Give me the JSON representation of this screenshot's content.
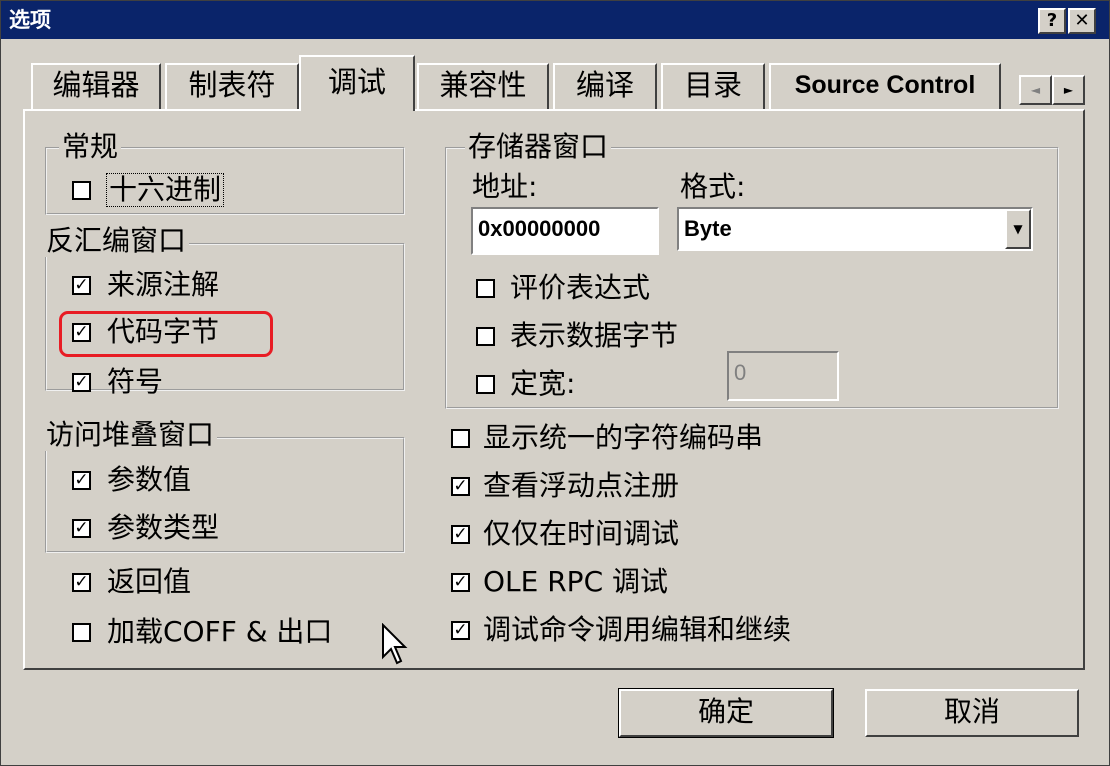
{
  "window": {
    "title": "选项"
  },
  "titlebar": {
    "help": "?",
    "close": "✕"
  },
  "tabs": [
    {
      "label": "编辑器"
    },
    {
      "label": "制表符"
    },
    {
      "label": "调试"
    },
    {
      "label": "兼容性"
    },
    {
      "label": "编译"
    },
    {
      "label": "目录"
    },
    {
      "label": "Source Control"
    }
  ],
  "tab_scroll": {
    "left": "◄",
    "right": "►"
  },
  "general": {
    "title": "常规",
    "items": [
      {
        "label": "十六进制",
        "checked": false
      }
    ]
  },
  "disasm": {
    "title": "反汇编窗口",
    "items": [
      {
        "label": "来源注解",
        "checked": true
      },
      {
        "label": "代码字节",
        "checked": true
      },
      {
        "label": "符号",
        "checked": true
      }
    ]
  },
  "callstack": {
    "title": "访问堆叠窗口",
    "items": [
      {
        "label": "参数值",
        "checked": true
      },
      {
        "label": "参数类型",
        "checked": true
      }
    ]
  },
  "left_extra": [
    {
      "label": "返回值",
      "checked": true
    },
    {
      "label": "加载COFF & 出口",
      "checked": false
    }
  ],
  "memory": {
    "title": "存储器窗口",
    "address_label": "地址:",
    "address_value": "0x00000000",
    "format_label": "格式:",
    "format_value": "Byte",
    "items": [
      {
        "label": "评价表达式",
        "checked": false
      },
      {
        "label": "表示数据字节",
        "checked": false
      },
      {
        "label": "定宽:",
        "checked": false
      }
    ],
    "fixed_width_value": "0"
  },
  "right_extra": [
    {
      "label": "显示统一的字符编码串",
      "checked": false
    },
    {
      "label": "查看浮动点注册",
      "checked": true
    },
    {
      "label": "仅仅在时间调试",
      "checked": true
    },
    {
      "label": "OLE RPC 调试",
      "checked": true
    },
    {
      "label": "调试命令调用编辑和继续",
      "checked": true
    }
  ],
  "buttons": {
    "ok": "确定",
    "cancel": "取消"
  },
  "check_mark": "✓",
  "colors": {
    "titlebar": "#0a246a",
    "face": "#d4d0c8",
    "highlight_box": "#e81c24"
  }
}
